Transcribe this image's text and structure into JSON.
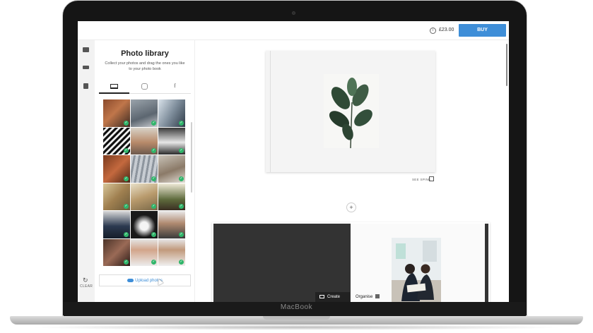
{
  "device": {
    "brand": "MacBook"
  },
  "header": {
    "price": "£23.00",
    "buy_label": "BUY"
  },
  "rail": {
    "clear_label": "CLEAR"
  },
  "library": {
    "title": "Photo library",
    "subtitle": "Collect your photos and drag the ones you like to your photo book",
    "tabs": [
      "computer",
      "instagram",
      "facebook"
    ],
    "facebook_glyph": "f",
    "upload_label": "Upload photos"
  },
  "canvas": {
    "see_spine_label": "SEE SPINE",
    "add_label": "+",
    "create_label": "Create",
    "organise_label": "Organise"
  },
  "colors": {
    "accent": "#3e8ed8",
    "check": "#2fb56a"
  }
}
